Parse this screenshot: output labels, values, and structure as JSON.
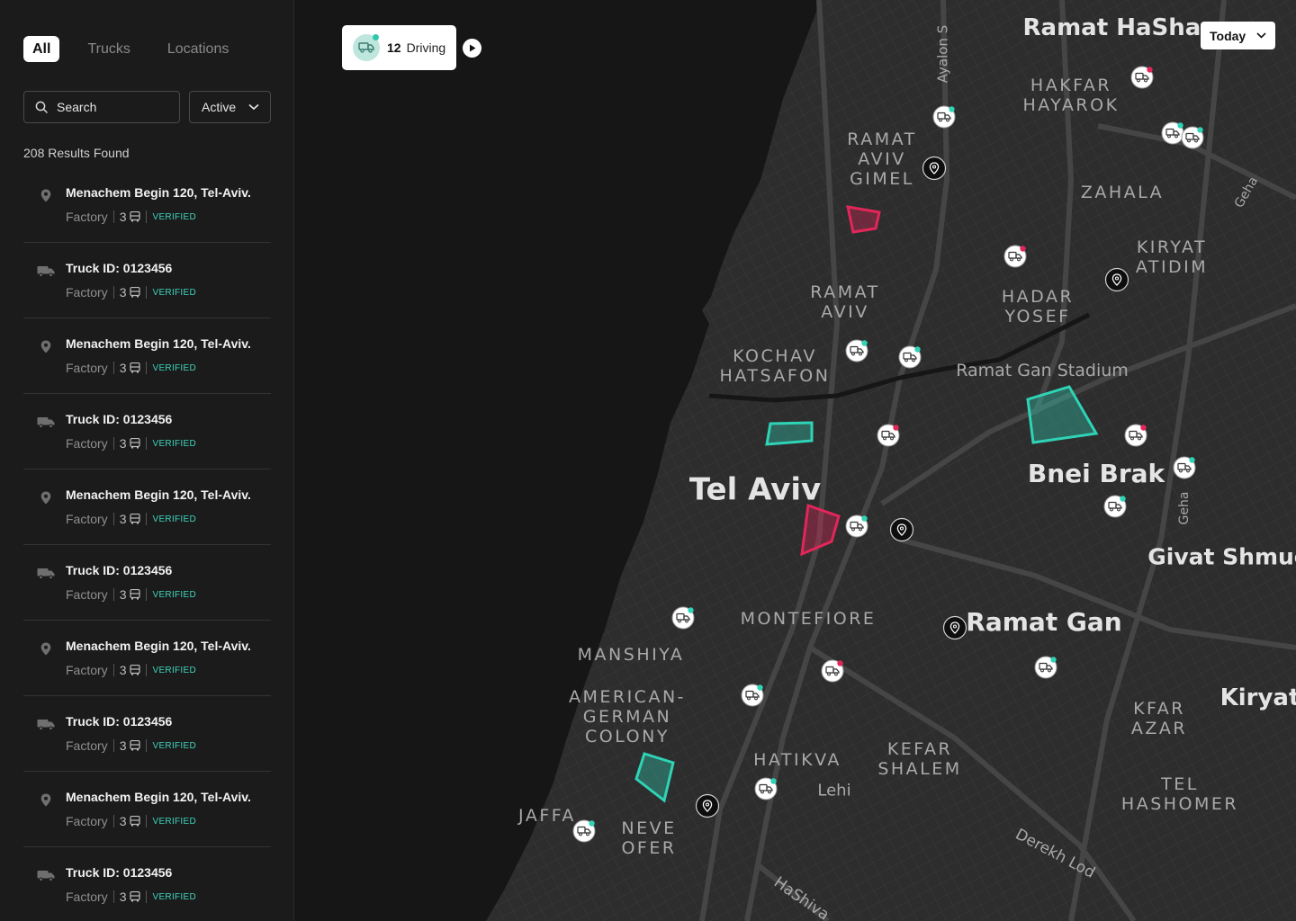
{
  "tabs": [
    "All",
    "Trucks",
    "Locations"
  ],
  "search": {
    "placeholder": "Search"
  },
  "filter": {
    "value": "Active"
  },
  "results_label": "208 Results Found",
  "list": [
    {
      "kind": "location",
      "title": "Menachem Begin 120, Tel-Aviv.",
      "type": "Factory",
      "count": "3",
      "badge": "VERIFIED"
    },
    {
      "kind": "truck",
      "title": "Truck ID: 0123456",
      "type": "Factory",
      "count": "3",
      "badge": "VERIFIED"
    },
    {
      "kind": "location",
      "title": "Menachem Begin 120, Tel-Aviv.",
      "type": "Factory",
      "count": "3",
      "badge": "VERIFIED"
    },
    {
      "kind": "truck",
      "title": "Truck ID: 0123456",
      "type": "Factory",
      "count": "3",
      "badge": "VERIFIED"
    },
    {
      "kind": "location",
      "title": "Menachem Begin 120, Tel-Aviv.",
      "type": "Factory",
      "count": "3",
      "badge": "VERIFIED"
    },
    {
      "kind": "truck",
      "title": "Truck ID: 0123456",
      "type": "Factory",
      "count": "3",
      "badge": "VERIFIED"
    },
    {
      "kind": "location",
      "title": "Menachem Begin 120, Tel-Aviv.",
      "type": "Factory",
      "count": "3",
      "badge": "VERIFIED"
    },
    {
      "kind": "truck",
      "title": "Truck ID: 0123456",
      "type": "Factory",
      "count": "3",
      "badge": "VERIFIED"
    },
    {
      "kind": "location",
      "title": "Menachem Begin 120, Tel-Aviv.",
      "type": "Factory",
      "count": "3",
      "badge": "VERIFIED"
    },
    {
      "kind": "truck",
      "title": "Truck ID: 0123456",
      "type": "Factory",
      "count": "3",
      "badge": "VERIFIED"
    }
  ],
  "driving": {
    "count": "12",
    "label": "Driving"
  },
  "date_filter": "Today",
  "map": {
    "places": [
      "Ramat HaSharon",
      "HAKFAR HAYAROK",
      "RAMAT AVIV GIMEL",
      "ZAHALA",
      "KIRYAT ATIDIM",
      "RAMAT AVIV",
      "HADAR YOSEF",
      "KOCHAV HATSAFON",
      "Ramat Gan Stadium",
      "Tel Aviv",
      "Bnei Brak",
      "Givat Shmue",
      "MONTEFIORE",
      "Ramat Gan",
      "MANSHIYA",
      "AMERICAN- GERMAN COLONY",
      "Kiryat",
      "KFAR AZAR",
      "HATIKVA",
      "KEFAR SHALEM",
      "Lehi",
      "TEL HASHOMER",
      "JAFFA",
      "NEVE OFER",
      "Derekh Lod",
      "HaShiva",
      "Ayalon S",
      "Geha",
      "Geha"
    ],
    "colors": {
      "teal": "#2fd3b6",
      "red": "#e2265a",
      "land": "#2f2f2f",
      "sea": "#161616"
    }
  }
}
